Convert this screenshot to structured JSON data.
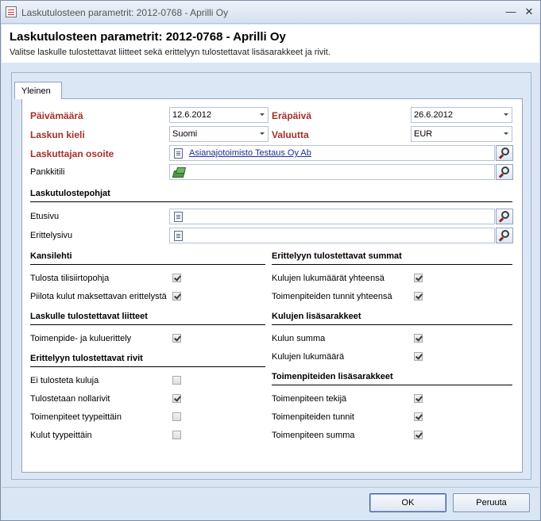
{
  "window": {
    "title": "Laskutulosteen parametrit: 2012-0768 - Aprilli Oy",
    "minimize": "—",
    "close": "✕"
  },
  "header": {
    "title": "Laskutulosteen parametrit: 2012-0768 - Aprilli Oy",
    "subtitle": "Valitse laskulle tulostettavat liitteet sekä erittelyyn tulostettavat lisäsarakkeet ja rivit."
  },
  "tab": {
    "label": "Yleinen"
  },
  "fields": {
    "paivamaara": {
      "label": "Päivämäärä",
      "value": "12.6.2012"
    },
    "erapaiva": {
      "label": "Eräpäivä",
      "value": "26.6.2012"
    },
    "laskun_kieli": {
      "label": "Laskun kieli",
      "value": "Suomi"
    },
    "valuutta": {
      "label": "Valuutta",
      "value": "EUR"
    },
    "laskuttajan_osoite": {
      "label": "Laskuttajan osoite",
      "value": "Asianajotoimisto Testaus Oy Ab"
    },
    "pankkitili": {
      "label": "Pankkitili",
      "value": ""
    },
    "etusivu": {
      "label": "Etusivu",
      "value": ""
    },
    "erittelysivu": {
      "label": "Erittelysivu",
      "value": ""
    }
  },
  "sections": {
    "laskutulostepohjat": "Laskutulostepohjat",
    "kansilehti": "Kansilehti",
    "liitteet": "Laskulle tulostettavat liitteet",
    "rivit": "Erittelyyn tulostettavat rivit",
    "summat": "Erittelyyn tulostettavat summat",
    "kulujen_lisasarakkeet": "Kulujen lisäsarakkeet",
    "toimenpiteiden_lisasarakkeet": "Toimenpiteiden lisäsarakkeet"
  },
  "checkboxes": {
    "tulosta_tilisiirtopohja": {
      "label": "Tulosta tilisiirtopohja",
      "checked": true
    },
    "piilota_kulut": {
      "label": "Piilota kulut maksettavan erittelystä",
      "checked": true
    },
    "toimenpide_ja_kulueritely": {
      "label": "Toimenpide- ja kuluerittely",
      "checked": true
    },
    "ei_tulosteta_kuluja": {
      "label": "Ei tulosteta kuluja",
      "checked": false
    },
    "tulostetaan_nollarivit": {
      "label": "Tulostetaan nollarivit",
      "checked": true
    },
    "toimenpiteet_tyypeittain": {
      "label": "Toimenpiteet tyypeittäin",
      "checked": false
    },
    "kulut_tyypeittain": {
      "label": "Kulut tyypeittäin",
      "checked": false
    },
    "kulujen_lukumaarat": {
      "label": "Kulujen lukumäärät yhteensä",
      "checked": true
    },
    "toimenpiteiden_tunnit_yht": {
      "label": "Toimenpiteiden tunnit yhteensä",
      "checked": true
    },
    "kulun_summa": {
      "label": "Kulun summa",
      "checked": true
    },
    "kulujen_lukumaara": {
      "label": "Kulujen lukumäärä",
      "checked": true
    },
    "toimenpiteen_tekija": {
      "label": "Toimenpiteen tekijä",
      "checked": true
    },
    "toimenpiteiden_tunnit": {
      "label": "Toimenpiteiden tunnit",
      "checked": true
    },
    "toimenpiteen_summa": {
      "label": "Toimenpiteen summa",
      "checked": true
    }
  },
  "buttons": {
    "ok": "OK",
    "cancel": "Peruuta"
  }
}
